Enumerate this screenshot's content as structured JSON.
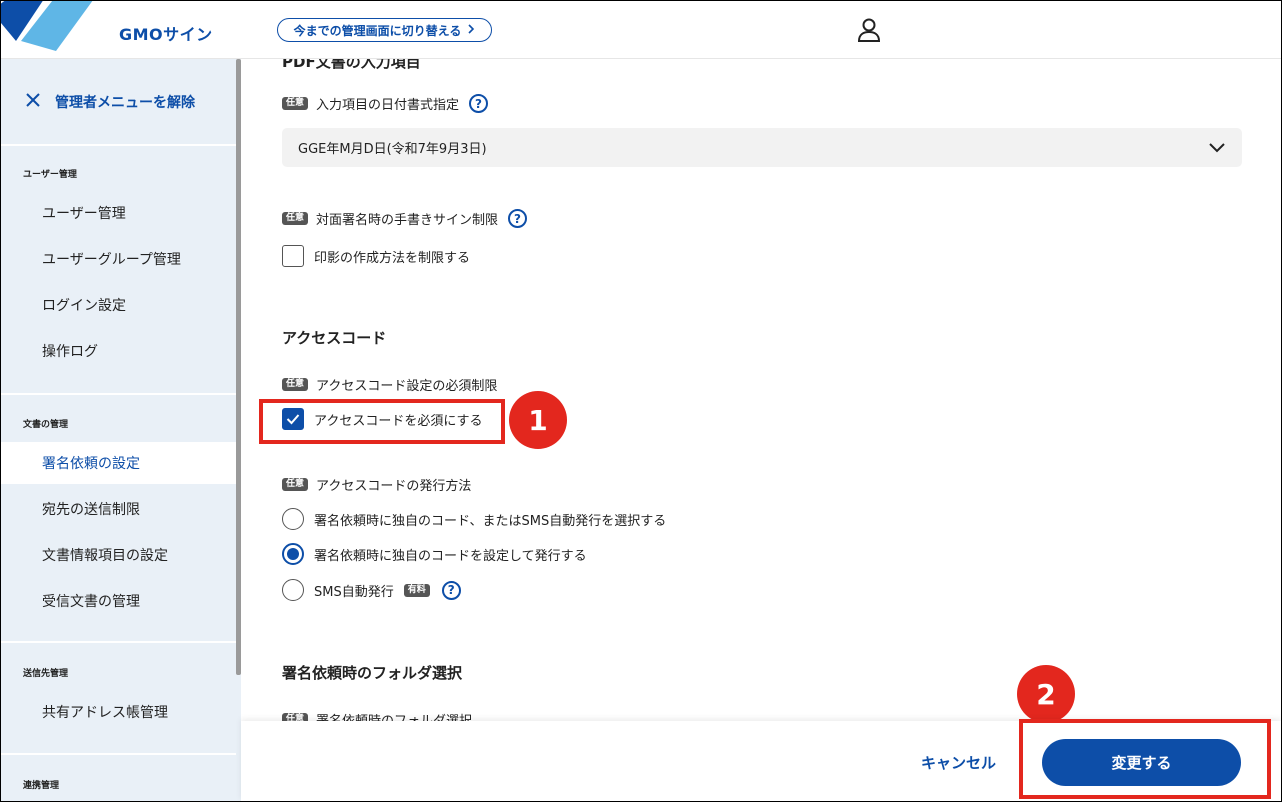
{
  "header": {
    "logo_text": "GMOサイン",
    "switch_button": "今までの管理画面に切り替える"
  },
  "sidebar": {
    "release_label": "管理者メニューを解除",
    "sections": [
      {
        "title": "ユーザー管理",
        "items": [
          "ユーザー管理",
          "ユーザーグループ管理",
          "ログイン設定",
          "操作ログ"
        ]
      },
      {
        "title": "文書の管理",
        "items": [
          "署名依頼の設定",
          "宛先の送信制限",
          "文書情報項目の設定",
          "受信文書の管理"
        ]
      },
      {
        "title": "送信先管理",
        "items": [
          "共有アドレス帳管理"
        ]
      },
      {
        "title": "連携管理",
        "items": []
      }
    ],
    "active_item": "署名依頼の設定"
  },
  "main": {
    "cut_heading": "PDF文書の入力項目",
    "date_format": {
      "badge": "任意",
      "label": "入力項目の日付書式指定",
      "value": "GGE年M月D日(令和7年9月3日)"
    },
    "handwriting": {
      "badge": "任意",
      "label": "対面署名時の手書きサイン制限",
      "checkbox_label": "印影の作成方法を制限する",
      "checked": false
    },
    "access_code": {
      "heading": "アクセスコード",
      "required": {
        "badge": "任意",
        "label": "アクセスコード設定の必須制限",
        "checkbox_label": "アクセスコードを必須にする",
        "checked": true
      },
      "issue_method": {
        "badge": "任意",
        "label": "アクセスコードの発行方法",
        "options": [
          "署名依頼時に独自のコード、またはSMS自動発行を選択する",
          "署名依頼時に独自のコードを設定して発行する",
          "SMS自動発行"
        ],
        "selected_index": 1,
        "paid_badge": "有料"
      }
    },
    "folder": {
      "heading": "署名依頼時のフォルダ選択",
      "badge": "任意",
      "label": "署名依頼時のフォルダ選択"
    }
  },
  "footer": {
    "cancel_label": "キャンセル",
    "submit_label": "変更する"
  },
  "annotations": {
    "step1": "1",
    "step2": "2",
    "color": "#e3271e"
  },
  "colors": {
    "brand": "#0d4ea8",
    "sidebar_bg": "#e9f0f7",
    "highlight": "#e3271e"
  }
}
